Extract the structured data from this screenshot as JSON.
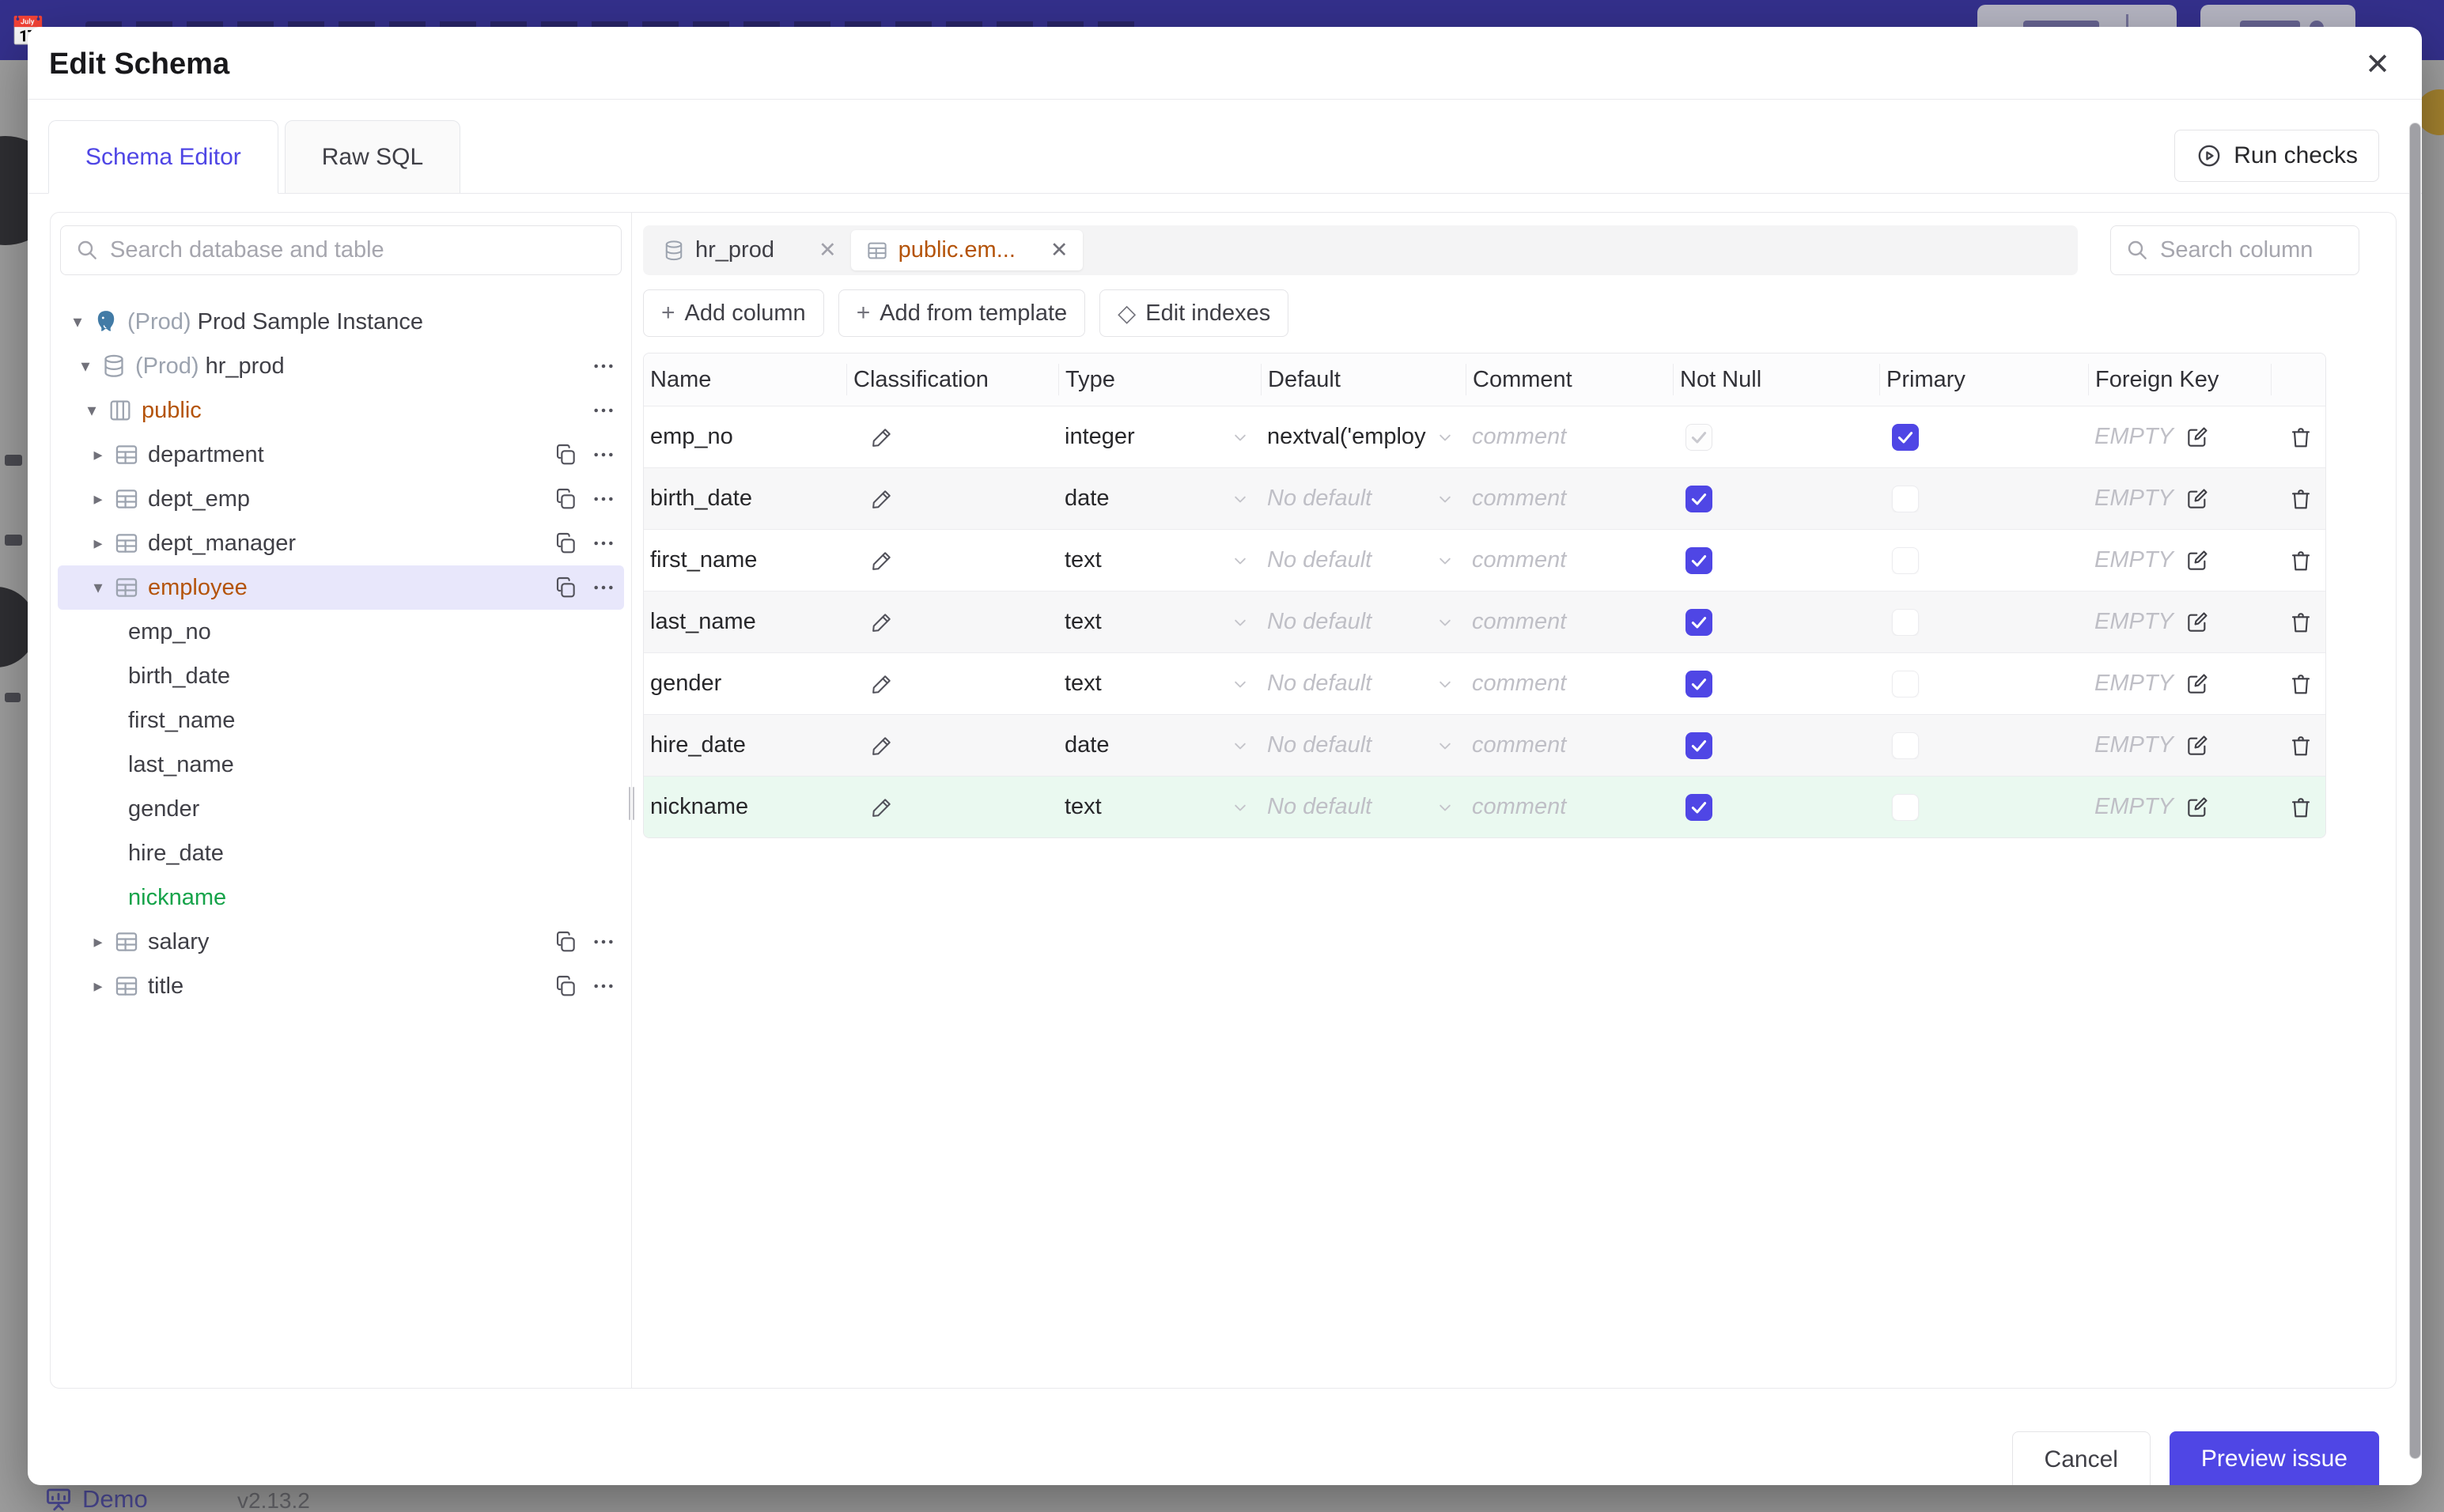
{
  "modal": {
    "title": "Edit Schema",
    "close_glyph": "✕",
    "tabs": [
      {
        "label": "Schema Editor",
        "active": true
      },
      {
        "label": "Raw SQL",
        "active": false
      }
    ],
    "run_checks_label": "Run checks",
    "footer": {
      "cancel": "Cancel",
      "submit": "Preview issue"
    }
  },
  "sidebar": {
    "search_placeholder": "Search database and table",
    "tree": [
      {
        "kind": "instance",
        "level": 0,
        "caret": "down",
        "icon": "postgres",
        "env": "(Prod) ",
        "label": "Prod Sample Instance",
        "color": null,
        "selected": false,
        "actions": []
      },
      {
        "kind": "database",
        "level": 1,
        "caret": "down",
        "icon": "database",
        "env": "(Prod) ",
        "label": "hr_prod",
        "color": null,
        "selected": false,
        "actions": [
          "more"
        ]
      },
      {
        "kind": "schema",
        "level": 2,
        "caret": "down",
        "icon": "schema",
        "env": "",
        "label": "public",
        "color": "amber",
        "selected": false,
        "actions": [
          "more"
        ]
      },
      {
        "kind": "table",
        "level": 3,
        "caret": "right",
        "icon": "table",
        "env": "",
        "label": "department",
        "color": null,
        "selected": false,
        "actions": [
          "copy",
          "more"
        ]
      },
      {
        "kind": "table",
        "level": 3,
        "caret": "right",
        "icon": "table",
        "env": "",
        "label": "dept_emp",
        "color": null,
        "selected": false,
        "actions": [
          "copy",
          "more"
        ]
      },
      {
        "kind": "table",
        "level": 3,
        "caret": "right",
        "icon": "table",
        "env": "",
        "label": "dept_manager",
        "color": null,
        "selected": false,
        "actions": [
          "copy",
          "more"
        ]
      },
      {
        "kind": "table",
        "level": 3,
        "caret": "down",
        "icon": "table",
        "env": "",
        "label": "employee",
        "color": "amber",
        "selected": true,
        "actions": [
          "copy",
          "more"
        ]
      },
      {
        "kind": "column",
        "level": 4,
        "caret": null,
        "icon": null,
        "env": "",
        "label": "emp_no",
        "color": null,
        "selected": false,
        "actions": []
      },
      {
        "kind": "column",
        "level": 4,
        "caret": null,
        "icon": null,
        "env": "",
        "label": "birth_date",
        "color": null,
        "selected": false,
        "actions": []
      },
      {
        "kind": "column",
        "level": 4,
        "caret": null,
        "icon": null,
        "env": "",
        "label": "first_name",
        "color": null,
        "selected": false,
        "actions": []
      },
      {
        "kind": "column",
        "level": 4,
        "caret": null,
        "icon": null,
        "env": "",
        "label": "last_name",
        "color": null,
        "selected": false,
        "actions": []
      },
      {
        "kind": "column",
        "level": 4,
        "caret": null,
        "icon": null,
        "env": "",
        "label": "gender",
        "color": null,
        "selected": false,
        "actions": []
      },
      {
        "kind": "column",
        "level": 4,
        "caret": null,
        "icon": null,
        "env": "",
        "label": "hire_date",
        "color": null,
        "selected": false,
        "actions": []
      },
      {
        "kind": "column",
        "level": 4,
        "caret": null,
        "icon": null,
        "env": "",
        "label": "nickname",
        "color": "green",
        "selected": false,
        "actions": []
      },
      {
        "kind": "table",
        "level": 3,
        "caret": "right",
        "icon": "table",
        "env": "",
        "label": "salary",
        "color": null,
        "selected": false,
        "actions": [
          "copy",
          "more"
        ]
      },
      {
        "kind": "table",
        "level": 3,
        "caret": "right",
        "icon": "table",
        "env": "",
        "label": "title",
        "color": null,
        "selected": false,
        "actions": [
          "copy",
          "more"
        ]
      }
    ]
  },
  "editor": {
    "chips": [
      {
        "label": "hr_prod",
        "icon": "database",
        "active": false
      },
      {
        "label": "public.em...",
        "icon": "table",
        "active": true
      }
    ],
    "search_placeholder": "Search column",
    "toolbar": [
      {
        "glyph": "+",
        "label": "Add column"
      },
      {
        "glyph": "+",
        "label": "Add from template"
      },
      {
        "glyph": "◇",
        "label": "Edit indexes"
      }
    ],
    "columns": [
      "Name",
      "Classification",
      "Type",
      "Default",
      "Comment",
      "Not Null",
      "Primary",
      "Foreign Key"
    ],
    "no_default_label": "No default",
    "comment_placeholder": "comment",
    "fk_empty_label": "EMPTY",
    "rows": [
      {
        "name": "emp_no",
        "type": "integer",
        "default": "nextval('employ",
        "not_null": {
          "checked": true,
          "disabled": true
        },
        "primary": {
          "checked": true,
          "disabled": false
        },
        "highlight": false
      },
      {
        "name": "birth_date",
        "type": "date",
        "default": null,
        "not_null": {
          "checked": true,
          "disabled": false
        },
        "primary": {
          "checked": false,
          "disabled": false
        },
        "highlight": false
      },
      {
        "name": "first_name",
        "type": "text",
        "default": null,
        "not_null": {
          "checked": true,
          "disabled": false
        },
        "primary": {
          "checked": false,
          "disabled": false
        },
        "highlight": false
      },
      {
        "name": "last_name",
        "type": "text",
        "default": null,
        "not_null": {
          "checked": true,
          "disabled": false
        },
        "primary": {
          "checked": false,
          "disabled": false
        },
        "highlight": false
      },
      {
        "name": "gender",
        "type": "text",
        "default": null,
        "not_null": {
          "checked": true,
          "disabled": false
        },
        "primary": {
          "checked": false,
          "disabled": false
        },
        "highlight": false
      },
      {
        "name": "hire_date",
        "type": "date",
        "default": null,
        "not_null": {
          "checked": true,
          "disabled": false
        },
        "primary": {
          "checked": false,
          "disabled": false
        },
        "highlight": false
      },
      {
        "name": "nickname",
        "type": "text",
        "default": null,
        "not_null": {
          "checked": true,
          "disabled": false
        },
        "primary": {
          "checked": false,
          "disabled": false
        },
        "highlight": true
      }
    ]
  },
  "background": {
    "emoji": "📅",
    "demo_label": "Demo",
    "version": "v2.13.2"
  },
  "colors": {
    "accent_indigo": "#4f46e5",
    "amber": "#b45309",
    "green": "#16a34a",
    "green_row": "#eaf9f0",
    "selected_row": "#e8e7fb",
    "header_band": "#34308c"
  }
}
